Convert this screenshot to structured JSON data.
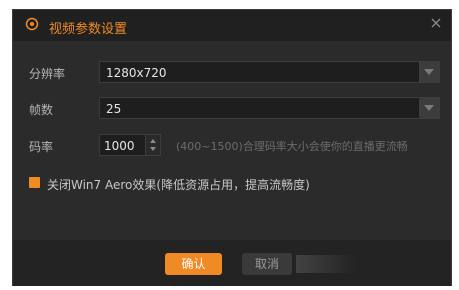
{
  "dialog": {
    "title": "视频参数设置",
    "icons": {
      "title": "target-icon",
      "close": "close-icon"
    },
    "accent_color": "#f08a24"
  },
  "form": {
    "resolution": {
      "label": "分辨率",
      "value": "1280x720"
    },
    "framerate": {
      "label": "帧数",
      "value": "25"
    },
    "bitrate": {
      "label": "码率",
      "value": "1000",
      "hint": "(400~1500)合理码率大小会使你的直播更流畅"
    },
    "aero": {
      "label": "关闭Win7 Aero效果(降低资源占用，提高流畅度)",
      "checked": true
    }
  },
  "footer": {
    "ok_label": "确认",
    "cancel_label": "取消"
  }
}
